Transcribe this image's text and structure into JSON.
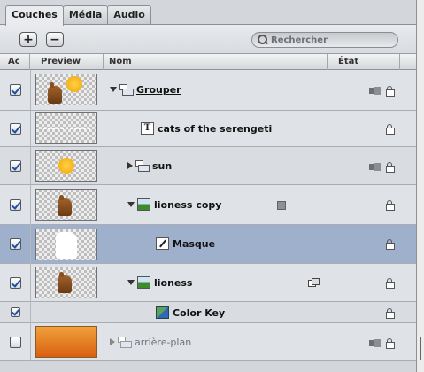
{
  "tabs": [
    {
      "label": "Couches",
      "active": true
    },
    {
      "label": "Média",
      "active": false
    },
    {
      "label": "Audio",
      "active": false
    }
  ],
  "toolbar": {
    "add_label": "+",
    "remove_label": "−",
    "search_placeholder": "Rechercher"
  },
  "header": {
    "active": "Ac",
    "preview": "Preview",
    "name": "Nom",
    "state": "État",
    "more": "›"
  },
  "rows": [
    {
      "name": "Grouper",
      "kind": "group",
      "expanded": true,
      "checked": true,
      "thumb": "cat-sun",
      "state": "group+lock"
    },
    {
      "name": "cats of the serengeti",
      "kind": "text",
      "checked": true,
      "thumb": "text",
      "state": "lock"
    },
    {
      "name": "sun",
      "kind": "group",
      "expanded": false,
      "checked": true,
      "thumb": "sun",
      "state": "group+lock"
    },
    {
      "name": "lioness copy",
      "kind": "image",
      "expanded": true,
      "checked": true,
      "thumb": "cat",
      "state": "lock"
    },
    {
      "name": "Masque",
      "kind": "mask",
      "checked": true,
      "thumb": "mask",
      "selected": true,
      "state": "lock"
    },
    {
      "name": "lioness",
      "kind": "image",
      "expanded": true,
      "checked": true,
      "thumb": "cat",
      "state": "lock"
    },
    {
      "name": "Color Key",
      "kind": "filter",
      "checked": true,
      "state": "lock"
    },
    {
      "name": "arrière-plan",
      "kind": "group",
      "expanded": false,
      "checked": false,
      "thumb": "gradient",
      "state": "group+lock",
      "dim": true
    }
  ]
}
